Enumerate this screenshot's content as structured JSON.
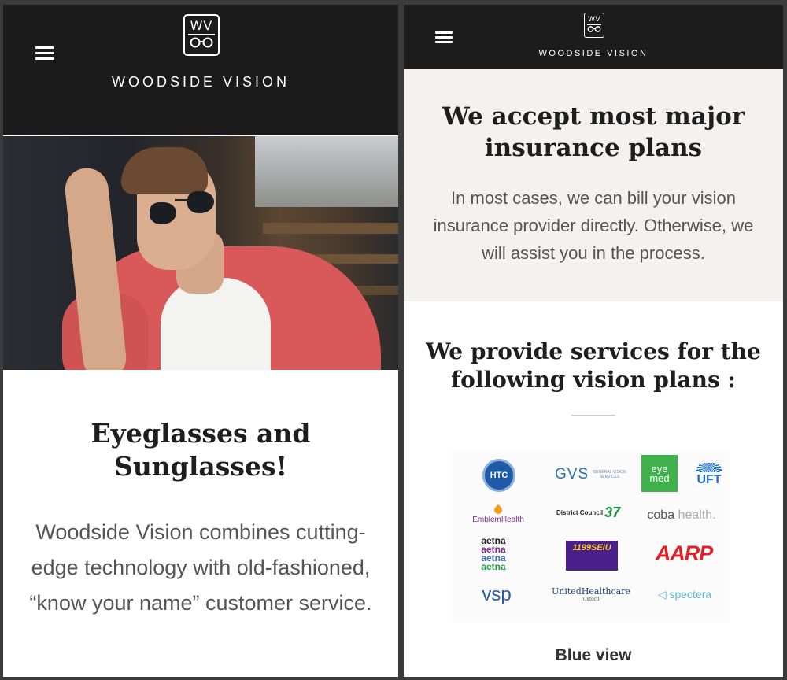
{
  "left_screen": {
    "brand": "WOODSIDE VISION",
    "logo_letters": "WV",
    "hero_alt": "",
    "headline": "Eyeglasses and Sunglasses!",
    "description": "Woodside Vision combines cutting-edge technology with old-fashioned, “know your name” customer service."
  },
  "right_screen": {
    "brand": "WOODSIDE VISION",
    "logo_letters": "WV",
    "insurance": {
      "title": "We accept most major insurance plans",
      "text": "In most cases, we can bill your vision insurance provider directly. Otherwise, we will assist you in the process."
    },
    "plans_title": "We provide services for the following vision plans :",
    "plan_logos": {
      "htc": "HTC",
      "gvs": "GVS",
      "gvs_sub": "GENERAL VISION SERVICES",
      "eyemed": "eye med",
      "uft": "UFT",
      "emblem": "EmblemHealth",
      "dc37_text": "District Council",
      "dc37_num": "37",
      "coba_main": "coba",
      "coba_sub": "health.",
      "aetna": [
        "aetna",
        "aetna",
        "aetna",
        "aetna"
      ],
      "seiu": "1199SEIU",
      "aarp": "AARP",
      "vsp": "vsp",
      "uhc": "UnitedHealthcare",
      "uhc_sub": "Oxford",
      "spectera": "spectera"
    },
    "next_plan_partial": "Blue view"
  },
  "colors": {
    "header_bg": "#1b1b1b",
    "insurance_bg": "#f3f2f1",
    "heading_text": "#1e1e1e",
    "body_text": "#555555"
  }
}
